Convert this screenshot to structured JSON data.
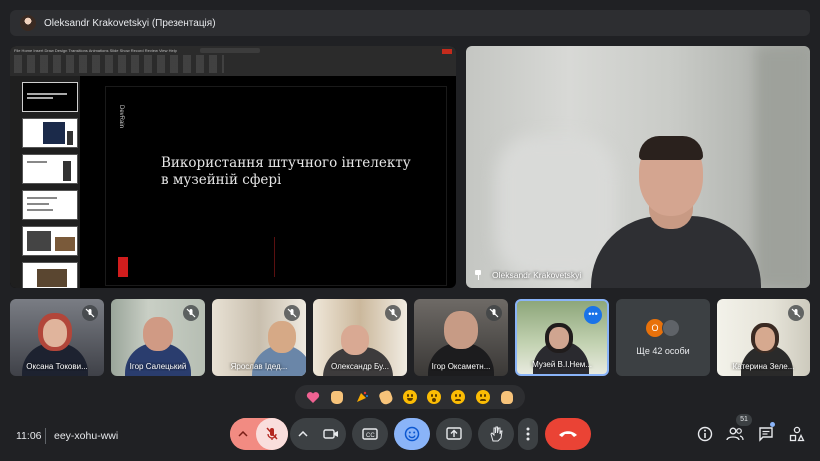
{
  "header": {
    "title": "Oleksandr Krakovetskyi (Презентація)"
  },
  "presentation": {
    "brand": "DevRain",
    "slide_title_line1": "Використання штучного інтелекту",
    "slide_title_line2": "в музейній сфері",
    "ribbon_tabs": "File  Home  Insert  Draw  Design  Transitions  Animations  Slide Show  Record  Review  View  Help"
  },
  "speaker": {
    "name": "Oleksandr Krakovetskyi"
  },
  "participants": [
    {
      "name": "Оксана Токови...",
      "muted": true
    },
    {
      "name": "Ігор Салецький",
      "muted": true
    },
    {
      "name": "Ярослав Ідед...",
      "muted": true
    },
    {
      "name": "Олександр Бу...",
      "muted": true
    },
    {
      "name": "Ігор Оксаметн...",
      "muted": true
    },
    {
      "name": "Музей В.І.Нем...",
      "muted": false
    },
    {
      "name": "Катерина Зеле...",
      "muted": true
    }
  ],
  "more_people": {
    "label": "Ще 42 особи",
    "avatar_letter": "О"
  },
  "reactions": [
    "sparkling-heart",
    "thumbs-up",
    "party-popper",
    "clapping-hands",
    "laughing-face",
    "surprised-face",
    "sad-face",
    "thinking-face",
    "thumbs-down"
  ],
  "footer": {
    "time": "11:06",
    "meeting_code": "eey-xohu-wwi",
    "participant_count": "51"
  },
  "colors": {
    "background": "#202124",
    "end_call": "#ea4335",
    "mic_muted": "#f9dedc",
    "active_blue": "#8ab4f8"
  }
}
